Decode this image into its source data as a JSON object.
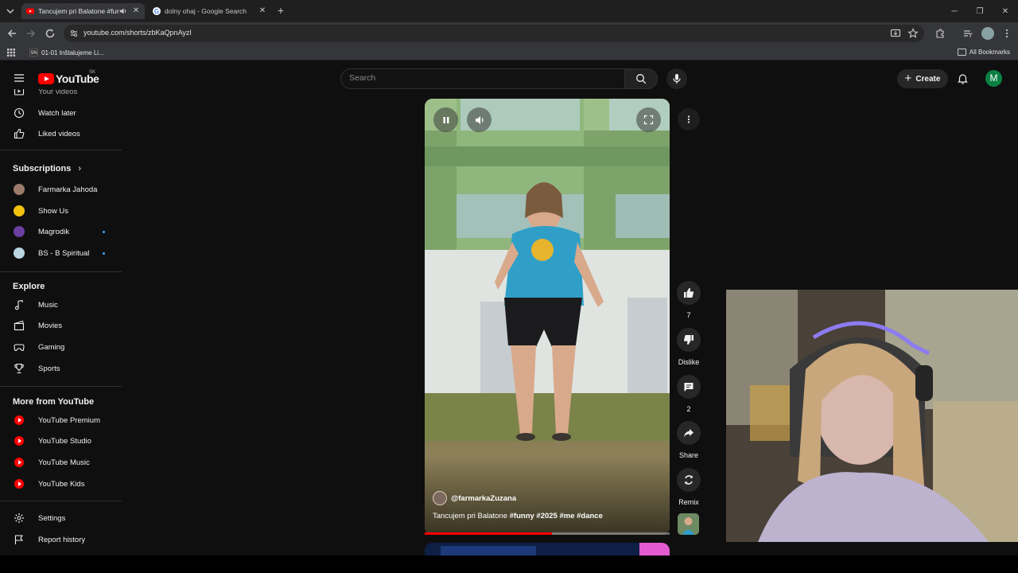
{
  "browser": {
    "tabs": [
      {
        "title": "Tancujem pri Balatone #funny",
        "active": true,
        "audio": true
      },
      {
        "title": "dolny ohaj - Google Search",
        "active": false
      }
    ],
    "url": "youtube.com/shorts/zbKaQpnAyzI",
    "bookmarks": [
      {
        "label": "01-01 Inštalujeme Li...",
        "favicon_text": "SN"
      }
    ],
    "all_bookmarks_label": "All Bookmarks",
    "profile_color": "#8aa1a3"
  },
  "header": {
    "logo_text": "YouTube",
    "country_code": "SK",
    "search_placeholder": "Search",
    "create_label": "Create",
    "avatar_letter": "M",
    "brand_color": "#ff0000",
    "avatar_color": "#0b8043"
  },
  "sidebar": {
    "top_items": [
      {
        "label": "Your videos",
        "icon": "your-videos-icon"
      },
      {
        "label": "Watch later",
        "icon": "clock-icon"
      },
      {
        "label": "Liked videos",
        "icon": "thumbs-up-icon"
      }
    ],
    "subscriptions_title": "Subscriptions",
    "subscriptions": [
      {
        "name": "Farmarka Jahoda",
        "new": false
      },
      {
        "name": "Show Us",
        "new": false
      },
      {
        "name": "Magrodik",
        "new": true
      },
      {
        "name": "BS - B Spiritual",
        "new": true
      }
    ],
    "explore_title": "Explore",
    "explore": [
      {
        "label": "Music",
        "icon": "music-note-icon"
      },
      {
        "label": "Movies",
        "icon": "clapperboard-icon"
      },
      {
        "label": "Gaming",
        "icon": "gamepad-icon"
      },
      {
        "label": "Sports",
        "icon": "trophy-icon"
      }
    ],
    "more_title": "More from YouTube",
    "more": [
      {
        "label": "YouTube Premium"
      },
      {
        "label": "YouTube Studio"
      },
      {
        "label": "YouTube Music"
      },
      {
        "label": "YouTube Kids"
      }
    ],
    "settings_label": "Settings",
    "report_label": "Report history"
  },
  "short": {
    "channel": "@farmarkaZuzana",
    "caption_text": "Tancujem pri Balatone ",
    "hashtags": "#funny #2025 #me #dance",
    "progress": 0.52,
    "actions": {
      "like_count": "7",
      "dislike_label": "Dislike",
      "comment_count": "2",
      "share_label": "Share",
      "remix_label": "Remix"
    }
  }
}
